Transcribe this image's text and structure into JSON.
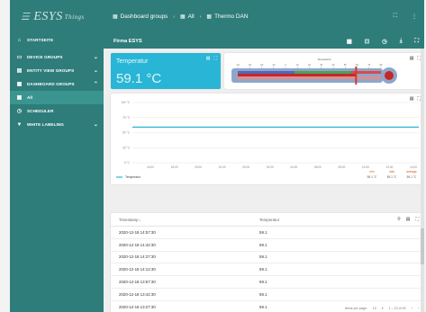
{
  "app": {
    "logo_text": "ESYS",
    "logo_sup": "Things"
  },
  "sidebar": {
    "items": [
      {
        "label": "STARTSEITE",
        "icon": "home-icon",
        "chevron": ""
      },
      {
        "label": "DEVICE GROUPS",
        "icon": "devices-icon",
        "chevron": "⌄"
      },
      {
        "label": "ENTITY VIEW GROUPS",
        "icon": "entity-view-icon",
        "chevron": "⌄"
      },
      {
        "label": "DASHBOARD GROUPS",
        "icon": "dashboard-icon",
        "chevron": "⌃"
      },
      {
        "label": "All",
        "icon": "dashboard-icon",
        "chevron": ""
      },
      {
        "label": "SCHEDULER",
        "icon": "clock-icon",
        "chevron": ""
      },
      {
        "label": "WHITE LABELING",
        "icon": "paint-icon",
        "chevron": "⌄"
      }
    ]
  },
  "header": {
    "breadcrumbs": [
      "Dashboard groups",
      "All",
      "Thermo DAN"
    ]
  },
  "dashboard": {
    "title": "Firma ESYS"
  },
  "temperature_card": {
    "title": "Temperatur",
    "value": "59.1 °C"
  },
  "thermometer": {
    "title": "Temperatur",
    "scale": [
      "-40",
      "-30",
      "-20",
      "-10",
      "0",
      "10",
      "20",
      "30",
      "40",
      "50",
      "60",
      "70",
      "80"
    ],
    "value": 59.1,
    "min": -40,
    "max": 80
  },
  "chart_data": {
    "type": "line",
    "title": "",
    "xlabel": "",
    "ylabel": "",
    "y_ticks": [
      "100 °C",
      "75 °C",
      "50 °C",
      "25 °C",
      "0 °C"
    ],
    "x_ticks": [
      "16:00",
      "18:00",
      "20:00",
      "22:00",
      "00:00",
      "02:00",
      "04:00",
      "06:00",
      "08:00",
      "10:00",
      "12:00",
      "14:00"
    ],
    "ylim": [
      0,
      100
    ],
    "series": [
      {
        "name": "Temperatur",
        "color": "#29b6d6",
        "values": [
          59.1,
          59.1,
          59.1,
          59.1,
          59.1,
          59.1,
          59.1,
          59.1,
          59.1,
          59.1,
          59.1,
          59.1
        ]
      }
    ],
    "stats": {
      "headers": [
        "min",
        "max",
        "average"
      ],
      "values": [
        "59.1 °C",
        "59.1 °C",
        "59.1 °C"
      ]
    }
  },
  "table": {
    "headers": [
      "Timestamp",
      "Temperatur"
    ],
    "rows": [
      [
        "2020-12-18 14:57:30",
        "59.1"
      ],
      [
        "2020-12-18 14:42:30",
        "59.1"
      ],
      [
        "2020-12-18 14:27:30",
        "59.1"
      ],
      [
        "2020-12-18 14:12:30",
        "59.1"
      ],
      [
        "2020-12-18 13:57:30",
        "59.1"
      ],
      [
        "2020-12-18 13:42:30",
        "59.1"
      ],
      [
        "2020-12-18 13:27:30",
        "59.1"
      ]
    ],
    "pager": {
      "items_per_page_label": "Items per page:",
      "items_per_page": "10",
      "range": "1 – 10 of 92"
    }
  }
}
